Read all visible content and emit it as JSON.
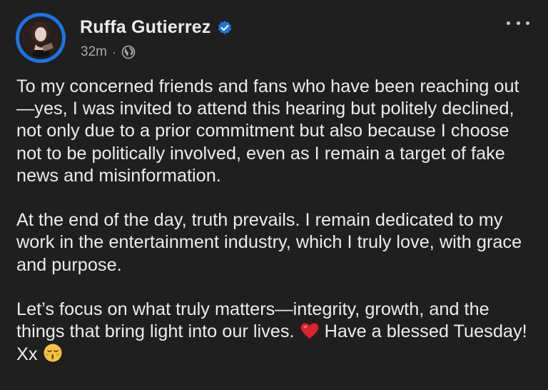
{
  "post": {
    "author_name": "Ruffa Gutierrez",
    "timestamp": "32m",
    "separator": "·",
    "audience_icon": "globe-icon",
    "verified_icon": "verified-badge-icon",
    "more_icon": "more-horizontal-icon",
    "paragraphs": {
      "p1": "To my concerned friends and fans who have been reaching out—yes, I was invited to attend this hearing but politely declined, not only due to a prior commitment but also because I choose not to be politically involved, even as I remain a target of fake news and misinformation.",
      "p2": "At the end of the day, truth prevails. I remain dedicated to my work in the entertainment industry, which I truly love, with grace and purpose.",
      "p3_part1": "Let’s focus on what truly matters—integrity, growth, and the things that bring light into our lives.",
      "p3_part2": "Have a blessed Tuesday! Xx"
    },
    "emoji": {
      "heart": "red-heart-icon",
      "kiss": "kissing-face-icon"
    }
  },
  "colors": {
    "background": "#1f1f1f",
    "text": "#ececec",
    "secondary_text": "#a8a8a8",
    "accent": "#1b74e4"
  }
}
